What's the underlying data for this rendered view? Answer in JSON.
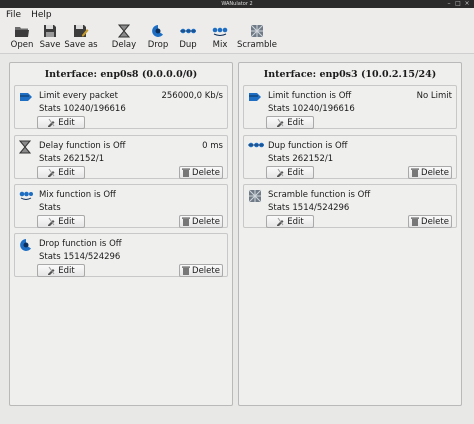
{
  "window": {
    "title": "WANulator 2"
  },
  "menu": {
    "file": "File",
    "help": "Help"
  },
  "toolbar": {
    "open": "Open",
    "save": "Save",
    "save_as": "Save as",
    "delay": "Delay",
    "drop": "Drop",
    "dup": "Dup",
    "mix": "Mix",
    "scramble": "Scramble"
  },
  "buttons": {
    "edit": "Edit",
    "delete": "Delete"
  },
  "left_panel": {
    "title": "Interface: enp0s8 (0.0.0.0/0)",
    "limit": {
      "title": "Limit every packet",
      "value": "256000,0 Kb/s",
      "stats": "Stats 10240/196616"
    },
    "delay": {
      "title": "Delay function is Off",
      "value": "0 ms",
      "stats": "Stats 262152/1"
    },
    "mix": {
      "title": "Mix function is Off",
      "stats": "Stats"
    },
    "drop": {
      "title": "Drop function is Off",
      "stats": "Stats 1514/524296"
    }
  },
  "right_panel": {
    "title": "Interface: enp0s3 (10.0.2.15/24)",
    "limit": {
      "title": "Limit function is Off",
      "value": "No Limit",
      "stats": "Stats 10240/196616"
    },
    "dup": {
      "title": "Dup function is Off",
      "stats": "Stats 262152/1"
    },
    "scramble": {
      "title": "Scramble function is Off",
      "stats": "Stats 1514/524296"
    }
  },
  "colors": {
    "accent_blue": "#1e6fc4",
    "window_bg": "#e8e8e7",
    "titlebar": "#2b2b2b"
  }
}
